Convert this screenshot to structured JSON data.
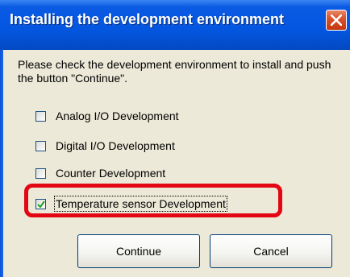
{
  "dialog": {
    "title": "Installing the development environment",
    "instructions": "Please check the development environment to install and push the button \"Continue\"."
  },
  "checkboxes": [
    {
      "label": "Analog I/O Development",
      "checked": false
    },
    {
      "label": "Digital I/O Development",
      "checked": false
    },
    {
      "label": "Counter Development",
      "checked": false
    },
    {
      "label": "Temperature sensor Development",
      "checked": true
    }
  ],
  "buttons": {
    "continue_label": "Continue",
    "cancel_label": "Cancel"
  },
  "icons": {
    "close": "close-icon",
    "checkmark": "checkmark-icon"
  },
  "colors": {
    "title_bar": "#0456e0",
    "close_button": "#d9532c",
    "dialog_background": "#ece9d8",
    "highlight_annotation": "#e30613"
  }
}
